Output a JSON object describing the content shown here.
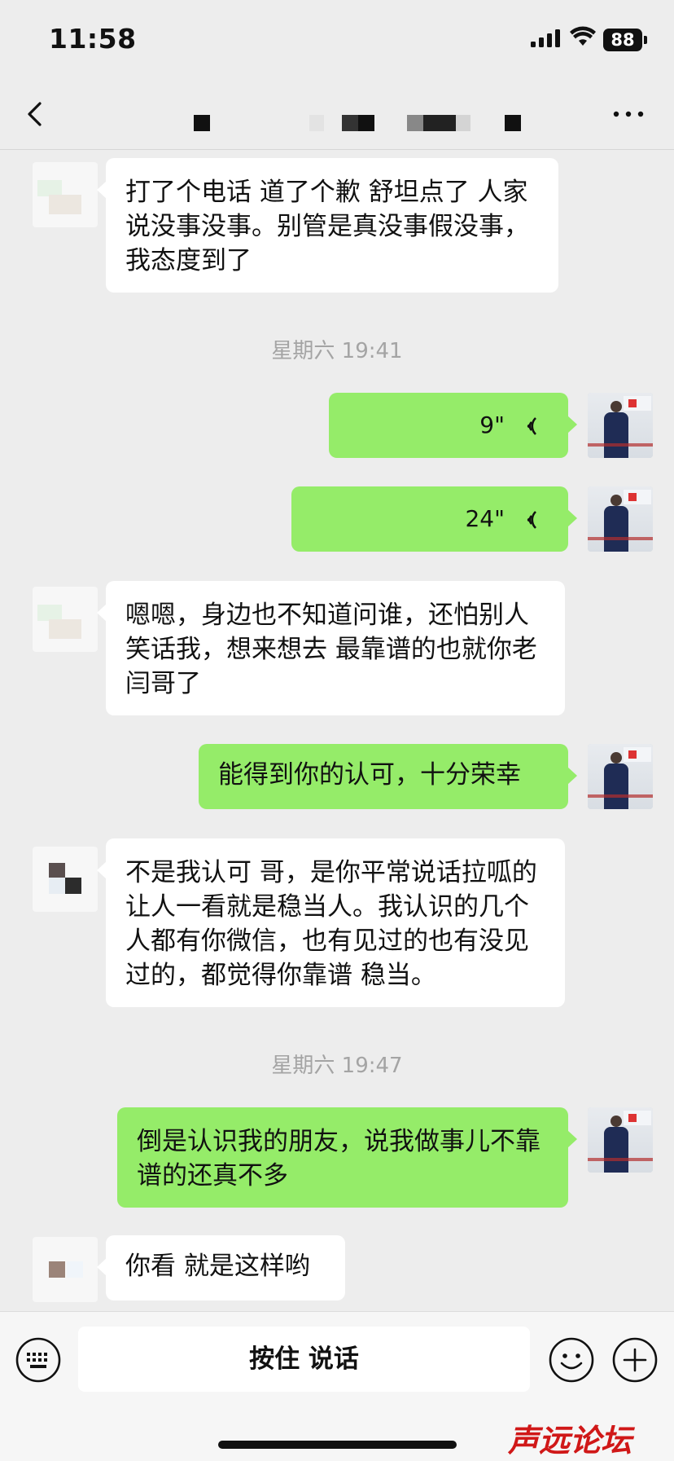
{
  "status_bar": {
    "time": "11:58",
    "battery": "88"
  },
  "nav": {
    "back_icon": "chevron-left-icon",
    "more_icon": "ellipsis-icon"
  },
  "messages": [
    {
      "side": "in",
      "text": "打了个电话 道了个歉  舒坦点了 人家说没事没事。别管是真没事假没事，我态度到了"
    },
    {
      "side": "time",
      "text": "星期六 19:41"
    },
    {
      "side": "out",
      "type": "voice",
      "duration": "9\""
    },
    {
      "side": "out",
      "type": "voice",
      "duration": "24\""
    },
    {
      "side": "in",
      "text": "嗯嗯，身边也不知道问谁，还怕别人笑话我，想来想去 最靠谱的也就你老闫哥了"
    },
    {
      "side": "out",
      "text": "能得到你的认可，十分荣幸"
    },
    {
      "side": "in",
      "text": "不是我认可 哥，是你平常说话拉呱的 让人一看就是稳当人。我认识的几个人都有你微信，也有见过的也有没见过的，都觉得你靠谱 稳当。"
    },
    {
      "side": "time",
      "text": "星期六 19:47"
    },
    {
      "side": "out",
      "text": "倒是认识我的朋友，说我做事儿不靠谱的还真不多"
    },
    {
      "side": "in",
      "text": "你看 就是这样哟"
    }
  ],
  "input_bar": {
    "hold_to_talk_label": "按住 说话",
    "keyboard_icon": "keyboard-icon",
    "emoji_icon": "emoji-icon",
    "plus_icon": "plus-icon"
  },
  "watermark": {
    "text": "声远论坛"
  },
  "colors": {
    "outgoing_bubble": "#95ec69",
    "incoming_bubble": "#ffffff",
    "background": "#ededed"
  }
}
